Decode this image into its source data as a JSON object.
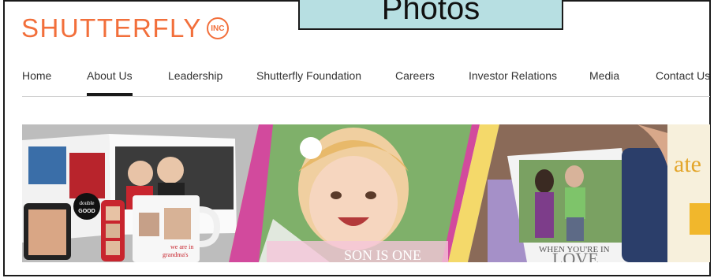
{
  "overlay": {
    "label": "Photos"
  },
  "brand": {
    "name": "SHUTTERFLY",
    "badge": "INC",
    "color": "#f26f3b"
  },
  "nav": {
    "items": [
      {
        "label": "Home",
        "active": false
      },
      {
        "label": "About Us",
        "active": true
      },
      {
        "label": "Leadership",
        "active": false
      },
      {
        "label": "Shutterfly Foundation",
        "active": false
      },
      {
        "label": "Careers",
        "active": false
      },
      {
        "label": "Investor Relations",
        "active": false
      },
      {
        "label": "Media",
        "active": false
      },
      {
        "label": "Contact Us",
        "active": false
      }
    ]
  },
  "banner": {
    "card_text_1": "double",
    "card_text_2": "GOOD",
    "mug_text_1": "we are in",
    "mug_text_2": "grandma's",
    "center_caption": "SON IS ONE",
    "right_caption_1": "WHEN YOU'RE IN",
    "right_caption_2": "LOVE",
    "invite_text": "ate"
  }
}
